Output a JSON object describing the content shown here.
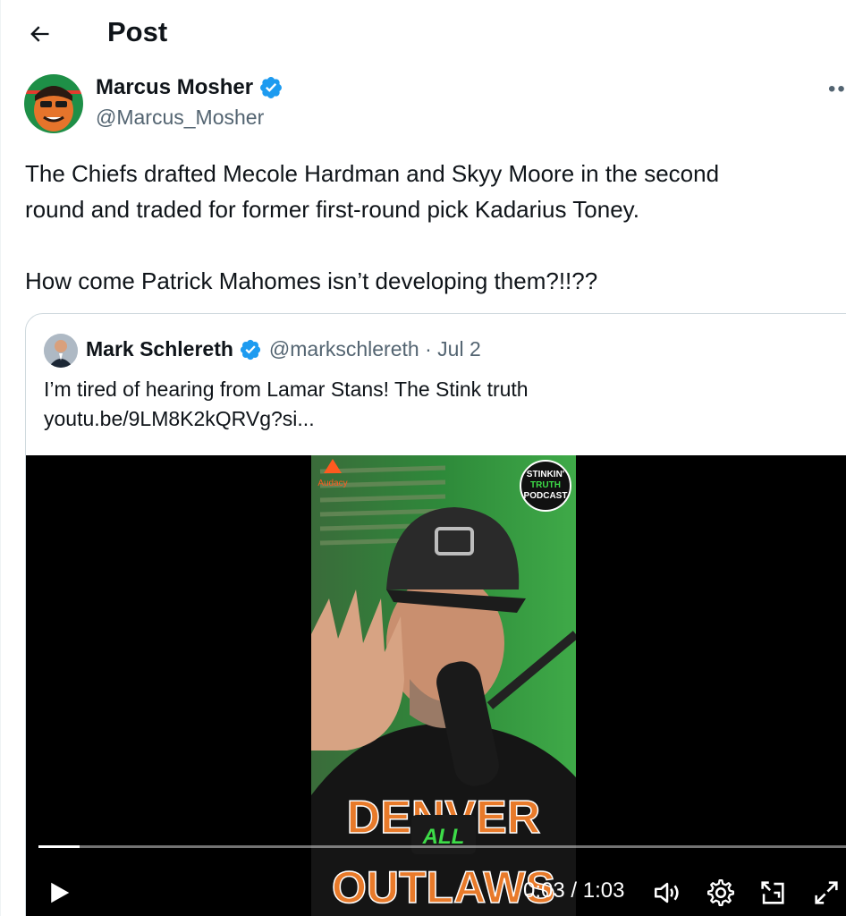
{
  "header": {
    "title": "Post"
  },
  "author": {
    "name": "Marcus Mosher",
    "handle": "@Marcus_Mosher"
  },
  "tweet": {
    "lines": [
      "The Chiefs drafted Mecole Hardman and Skyy Moore in the second",
      "round and traded for former first-round pick Kadarius Toney.",
      "How come Patrick Mahomes isn’t developing them?!!??"
    ]
  },
  "quote": {
    "name": "Mark Schlereth",
    "handle": "@markschlereth",
    "separator": " · ",
    "date": "Jul 2",
    "text_line1": "I’m tired of hearing from Lamar Stans! The Stink truth",
    "text_line2": "youtu.be/9LM8K2kQRVg?si..."
  },
  "video": {
    "brand_logo": "Audacy",
    "podcast_badge": [
      "STINKIN'",
      "TRUTH",
      "PODCAST"
    ],
    "shirt_text_top": "DENVER",
    "shirt_text_bottom": "OUTLAWS",
    "caption": "ALL",
    "time_current": "0:03",
    "time_separator": " / ",
    "time_total": "1:03",
    "progress_fraction": 0.05
  },
  "icons": {
    "back": "arrow-left-icon",
    "verified": "verified-badge-icon",
    "more": "more-icon",
    "play": "play-icon",
    "volume": "volume-icon",
    "settings": "gear-icon",
    "pip": "picture-in-picture-icon",
    "fullscreen": "fullscreen-icon"
  },
  "colors": {
    "verified": "#1d9bf0",
    "handle": "#536471",
    "border": "#cfd9de",
    "video_bg": "#000000"
  }
}
